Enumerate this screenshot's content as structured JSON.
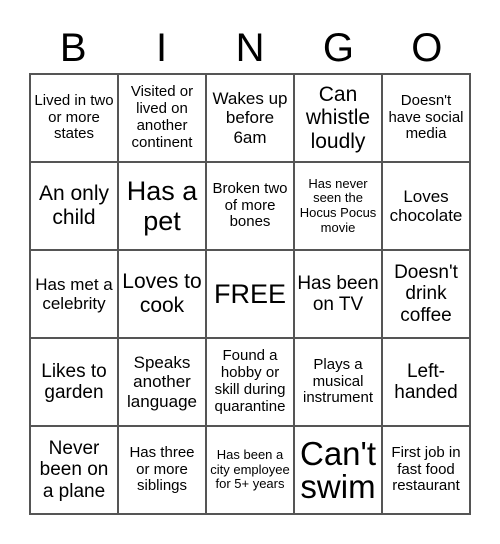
{
  "header": [
    "B",
    "I",
    "N",
    "G",
    "O"
  ],
  "cells": [
    "Lived in two or more states",
    "Visited or lived on another continent",
    "Wakes up before 6am",
    "Can whistle loudly",
    "Doesn't have social media",
    "An only child",
    "Has a pet",
    "Broken two of more bones",
    "Has never seen the Hocus Pocus movie",
    "Loves chocolate",
    "Has met a celebrity",
    "Loves to cook",
    "FREE",
    "Has been on TV",
    "Doesn't drink coffee",
    "Likes to garden",
    "Speaks another language",
    "Found a hobby or skill during quarantine",
    "Plays a musical instrument",
    "Left-handed",
    "Never been on a plane",
    "Has three or more siblings",
    "Has been a city employee for 5+ years",
    "Can't swim",
    "First job in fast food restaurant"
  ]
}
